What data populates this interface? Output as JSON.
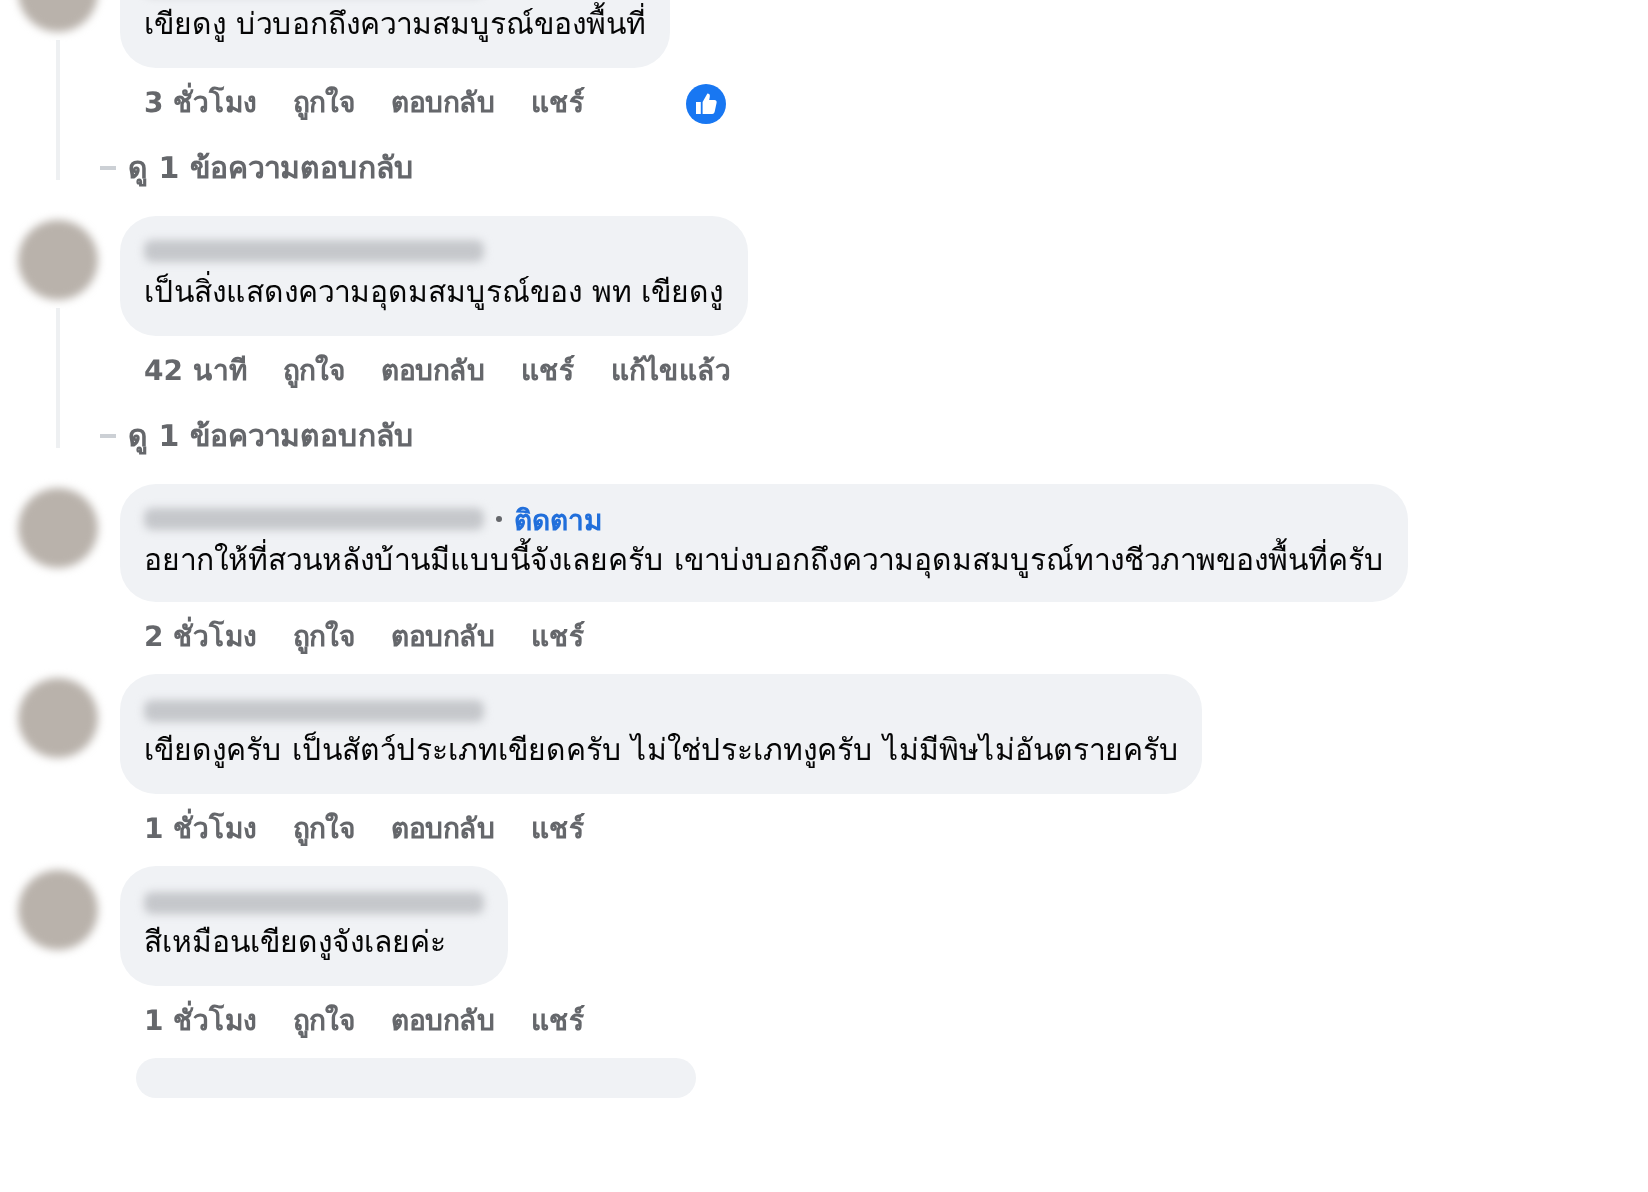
{
  "comments": [
    {
      "text": "เขียดงู บ่วบอกถึงความสมบูรณ์ของพื้นที่",
      "time": "3 ชั่วโมง",
      "actions": [
        "ถูกใจ",
        "ตอบกลับ",
        "แชร์"
      ],
      "reaction": {
        "kind": "like"
      },
      "replies_link": "ดู 1 ข้อความตอบกลับ"
    },
    {
      "text": "เป็นสิ่งแสดงความอุดมสมบูรณ์ของ พท เขียดงู",
      "time": "42 นาที",
      "actions": [
        "ถูกใจ",
        "ตอบกลับ",
        "แชร์"
      ],
      "edited": "แก้ไขแล้ว",
      "replies_link": "ดู 1 ข้อความตอบกลับ"
    },
    {
      "text": "อยากให้ที่สวนหลังบ้านมีแบบนี้จังเลยครับ เขาบ่งบอกถึงความอุดมสมบูรณ์ทางชีวภาพของพื้นที่ครับ",
      "follow": "ติดตาม",
      "time": "2 ชั่วโมง",
      "actions": [
        "ถูกใจ",
        "ตอบกลับ",
        "แชร์"
      ]
    },
    {
      "text": "เขียดงูครับ เป็นสัตว์ประเภทเขียดครับ ไม่ใช่ประเภทงูครับ ไม่มีพิษไม่อันตรายครับ",
      "time": "1 ชั่วโมง",
      "actions": [
        "ถูกใจ",
        "ตอบกลับ",
        "แชร์"
      ]
    },
    {
      "text": "สีเหมือนเขียดงูจังเลยค่ะ",
      "time": "1 ชั่วโมง",
      "actions": [
        "ถูกใจ",
        "ตอบกลับ",
        "แชร์"
      ]
    }
  ]
}
